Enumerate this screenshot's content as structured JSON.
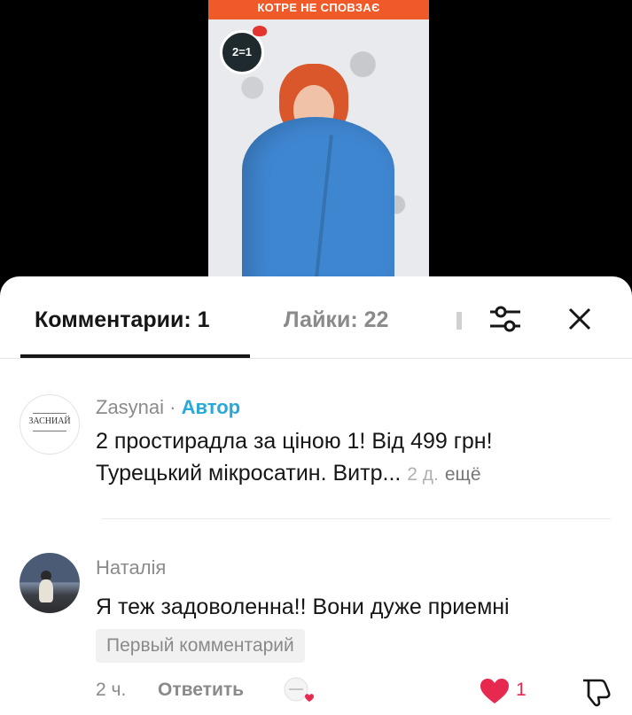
{
  "video": {
    "banner_text": "КОТРЕ НЕ СПОВЗАЄ",
    "badge_text": "2=1"
  },
  "tabs": {
    "comments_label": "Комментарии: 1",
    "likes_label": "Лайки: 22"
  },
  "comments": [
    {
      "username": "Zasynai",
      "separator": " · ",
      "author_tag": "Автор",
      "avatar_text": "ЗАСНИАЙ",
      "line1": "2 простирадла за ціною 1! Від 499 грн!",
      "line2": "Турецький мікросатин. Витр...",
      "time": "2 д.",
      "more": "ещё"
    },
    {
      "username": "Наталія",
      "text": "Я теж задоволенна!! Вони дуже приемні",
      "badge": "Первый комментарий",
      "time": "2 ч.",
      "reply": "Ответить",
      "like_count": "1"
    }
  ],
  "colors": {
    "accent_author": "#2aa8d8",
    "like_red": "#e8294f",
    "banner_orange": "#f05a28"
  }
}
